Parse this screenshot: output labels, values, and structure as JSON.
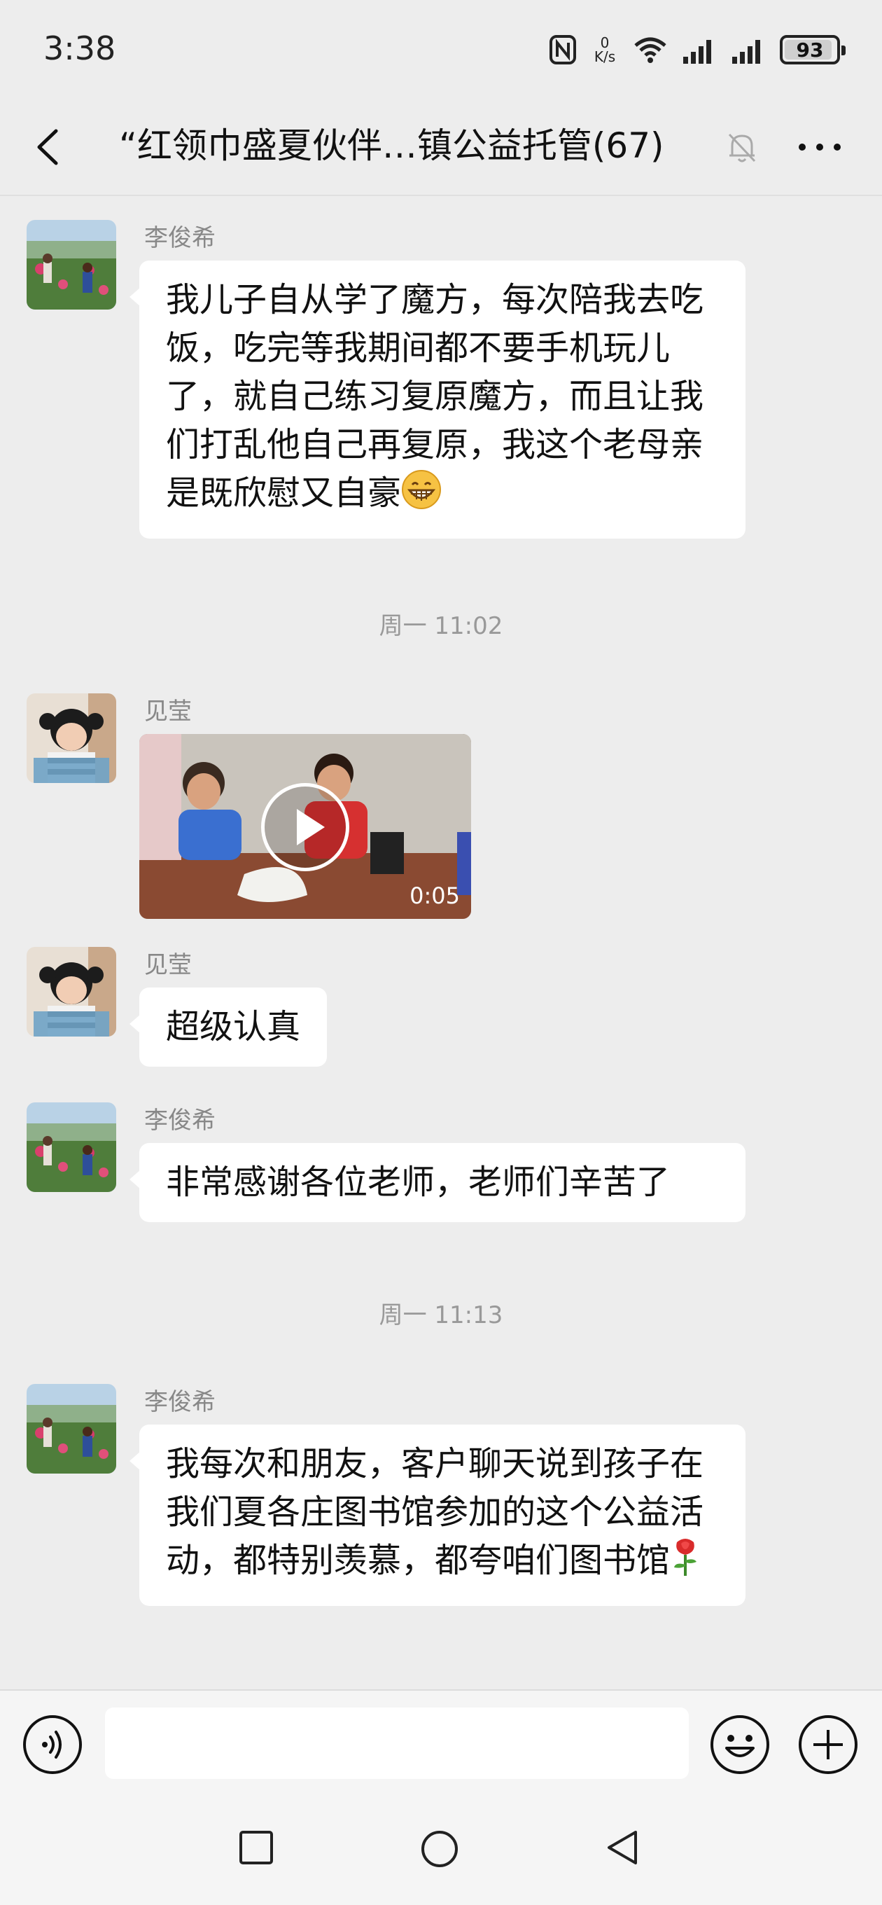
{
  "status_bar": {
    "time": "3:38",
    "net_speed_value": "0",
    "net_speed_unit": "K/s",
    "battery": "93"
  },
  "header": {
    "title": "“红领巾盛夏伙伴…镇公益托管(67)"
  },
  "messages": [
    {
      "sender": "李俊希",
      "text": "我儿子自从学了魔方，每次陪我去吃饭，吃完等我期间都不要手机玩儿了，就自己练习复原魔方，而且让我们打乱他自己再复原，我这个老母亲是既欣慰又自豪",
      "emoji": "grinning-face"
    },
    {
      "timestamp": "周一 11:02"
    },
    {
      "sender": "见莹",
      "video_duration": "0:05"
    },
    {
      "sender": "见莹",
      "text": "超级认真"
    },
    {
      "sender": "李俊希",
      "text": "非常感谢各位老师，老师们辛苦了"
    },
    {
      "timestamp": "周一 11:13"
    },
    {
      "sender": "李俊希",
      "text": "我每次和朋友，客户聊天说到孩子在我们夏各庄图书馆参加的这个公益活动，都特别羡慕，都夸咱们图书馆",
      "emoji": "rose"
    }
  ],
  "input": {
    "placeholder": ""
  },
  "colors": {
    "background": "#ededed",
    "bubble": "#ffffff",
    "meta_text": "#999999"
  }
}
